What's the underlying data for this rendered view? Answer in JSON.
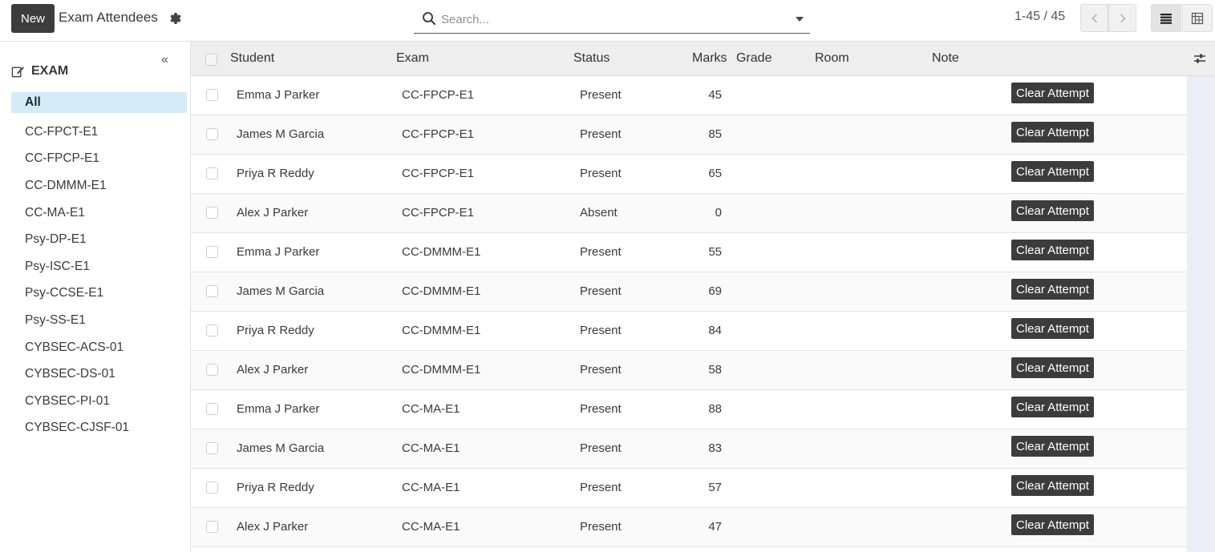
{
  "header": {
    "new_label": "New",
    "title": "Exam Attendees",
    "search_placeholder": "Search...",
    "pager": "1-45 / 45"
  },
  "sidebar": {
    "collapse_glyph": "«",
    "title": "EXAM",
    "items": [
      {
        "label": "All",
        "active": true
      },
      {
        "label": "CC-FPCT-E1"
      },
      {
        "label": "CC-FPCP-E1"
      },
      {
        "label": "CC-DMMM-E1"
      },
      {
        "label": "CC-MA-E1"
      },
      {
        "label": "Psy-DP-E1"
      },
      {
        "label": "Psy-ISC-E1"
      },
      {
        "label": "Psy-CCSE-E1"
      },
      {
        "label": "Psy-SS-E1"
      },
      {
        "label": "CYBSEC-ACS-01"
      },
      {
        "label": "CYBSEC-DS-01"
      },
      {
        "label": "CYBSEC-PI-01"
      },
      {
        "label": "CYBSEC-CJSF-01"
      }
    ]
  },
  "table": {
    "columns": {
      "student": "Student",
      "exam": "Exam",
      "status": "Status",
      "marks": "Marks",
      "grade": "Grade",
      "room": "Room",
      "note": "Note"
    },
    "clear_label": "Clear Attempt",
    "rows": [
      {
        "student": "Emma J Parker",
        "exam": "CC-FPCP-E1",
        "status": "Present",
        "marks": "45"
      },
      {
        "student": "James M Garcia",
        "exam": "CC-FPCP-E1",
        "status": "Present",
        "marks": "85"
      },
      {
        "student": "Priya R Reddy",
        "exam": "CC-FPCP-E1",
        "status": "Present",
        "marks": "65"
      },
      {
        "student": "Alex J Parker",
        "exam": "CC-FPCP-E1",
        "status": "Absent",
        "marks": "0"
      },
      {
        "student": "Emma J Parker",
        "exam": "CC-DMMM-E1",
        "status": "Present",
        "marks": "55"
      },
      {
        "student": "James M Garcia",
        "exam": "CC-DMMM-E1",
        "status": "Present",
        "marks": "69"
      },
      {
        "student": "Priya R Reddy",
        "exam": "CC-DMMM-E1",
        "status": "Present",
        "marks": "84"
      },
      {
        "student": "Alex J Parker",
        "exam": "CC-DMMM-E1",
        "status": "Present",
        "marks": "58"
      },
      {
        "student": "Emma J Parker",
        "exam": "CC-MA-E1",
        "status": "Present",
        "marks": "88"
      },
      {
        "student": "James M Garcia",
        "exam": "CC-MA-E1",
        "status": "Present",
        "marks": "83"
      },
      {
        "student": "Priya R Reddy",
        "exam": "CC-MA-E1",
        "status": "Present",
        "marks": "57"
      },
      {
        "student": "Alex J Parker",
        "exam": "CC-MA-E1",
        "status": "Present",
        "marks": "47"
      }
    ]
  }
}
